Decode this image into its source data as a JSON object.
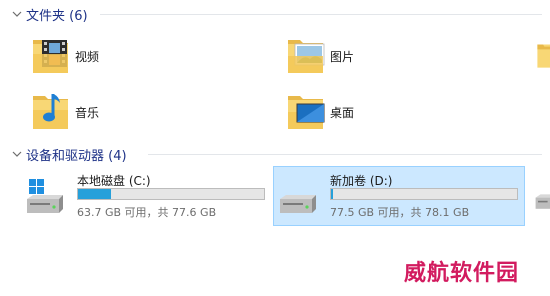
{
  "groups": {
    "folders": {
      "title": "文件夹 (6)"
    },
    "devices": {
      "title": "设备和驱动器 (4)"
    }
  },
  "folders": [
    {
      "label": "视频",
      "icon": "videos-folder-icon"
    },
    {
      "label": "图片",
      "icon": "pictures-folder-icon"
    },
    {
      "label": "音乐",
      "icon": "music-folder-icon"
    },
    {
      "label": "桌面",
      "icon": "desktop-folder-icon"
    }
  ],
  "drives": [
    {
      "name": "本地磁盘 (C:)",
      "info": "63.7 GB 可用，共 77.6 GB",
      "used_fraction": 0.179,
      "selected": false,
      "icon": "windows-drive-icon"
    },
    {
      "name": "新加卷 (D:)",
      "info": "77.5 GB 可用，共 78.1 GB",
      "used_fraction": 0.008,
      "selected": true,
      "icon": "hard-drive-icon"
    }
  ],
  "watermark": "威航软件园",
  "colors": {
    "group_title": "#1e3287",
    "selection_bg": "#cce8ff",
    "selection_border": "#99d1ff",
    "usage_bar": "#26a0da",
    "watermark": "#d21b5f"
  }
}
